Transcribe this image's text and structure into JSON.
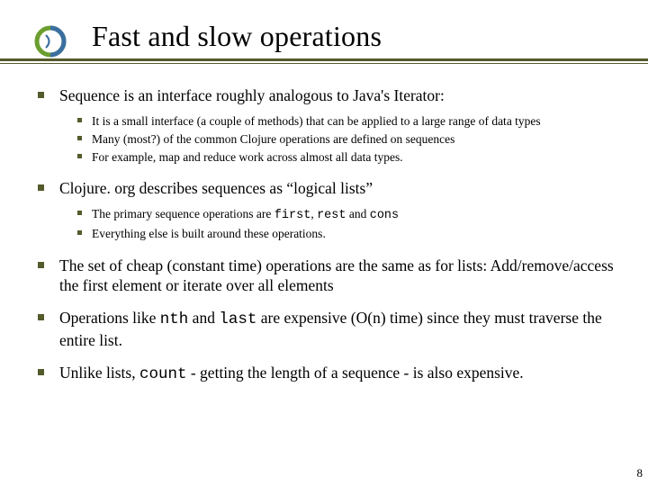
{
  "title": "Fast and slow operations",
  "bullets": [
    {
      "text": "Sequence is an interface roughly analogous to Java's Iterator:",
      "sub": [
        "It is a small interface (a couple of methods) that can be applied to a large range of data types",
        "Many (most?) of the common Clojure operations are defined on sequences",
        "For example, map and reduce work across almost all data types."
      ]
    },
    {
      "text": "Clojure. org describes sequences as “logical lists”",
      "sub": [
        " The primary sequence operations are <span class=\"code\">first</span>, <span class=\"code\">rest</span> and <span class=\"code\">cons</span>",
        "Everything else is built around these operations."
      ]
    },
    {
      "text": "The set of cheap (constant time) operations are the same as for lists: Add/remove/access the first element or iterate over all elements"
    },
    {
      "text": "Operations like <span class=\"code\">nth</span> and <span class=\"code\">last</span> are expensive (O(n) time) since they must traverse the entire list."
    },
    {
      "text": "Unlike lists, <span class=\"code\">count</span> - getting the length of a sequence - is also expensive."
    }
  ],
  "page_number": "8"
}
